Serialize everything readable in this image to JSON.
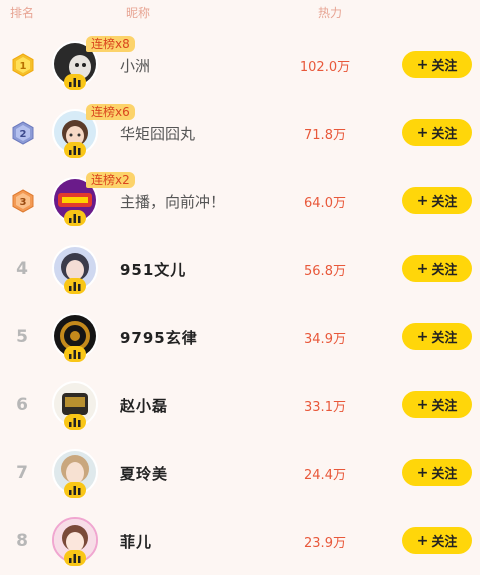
{
  "header": {
    "rank": "排名",
    "nickname": "昵称",
    "heat": "热力"
  },
  "rows": [
    {
      "rank": "1",
      "name": "小洲",
      "heat": "102.0万",
      "streak": "连榜x8",
      "follow": "关注"
    },
    {
      "rank": "2",
      "name": "华矩囧囧丸",
      "heat": "71.8万",
      "streak": "连榜x6",
      "follow": "关注"
    },
    {
      "rank": "3",
      "name": "主播，向前冲！",
      "heat": "64.0万",
      "streak": "连榜x2",
      "follow": "关注"
    },
    {
      "rank": "4",
      "name": "951文儿",
      "heat": "56.8万",
      "follow": "关注"
    },
    {
      "rank": "5",
      "name": "9795玄律",
      "heat": "34.9万",
      "follow": "关注"
    },
    {
      "rank": "6",
      "name": "赵小磊",
      "heat": "33.1万",
      "follow": "关注"
    },
    {
      "rank": "7",
      "name": "夏玲美",
      "heat": "24.4万",
      "follow": "关注"
    },
    {
      "rank": "8",
      "name": "菲儿",
      "heat": "23.9万",
      "follow": "关注"
    }
  ],
  "colors": {
    "gold": "#f5c02a",
    "silver": "#8c9bd6",
    "bronze": "#f39a54",
    "accent": "#ffd60a",
    "heat": "#e8583a"
  },
  "icons": {
    "live": "live-bars-icon",
    "plus": "plus-icon"
  }
}
